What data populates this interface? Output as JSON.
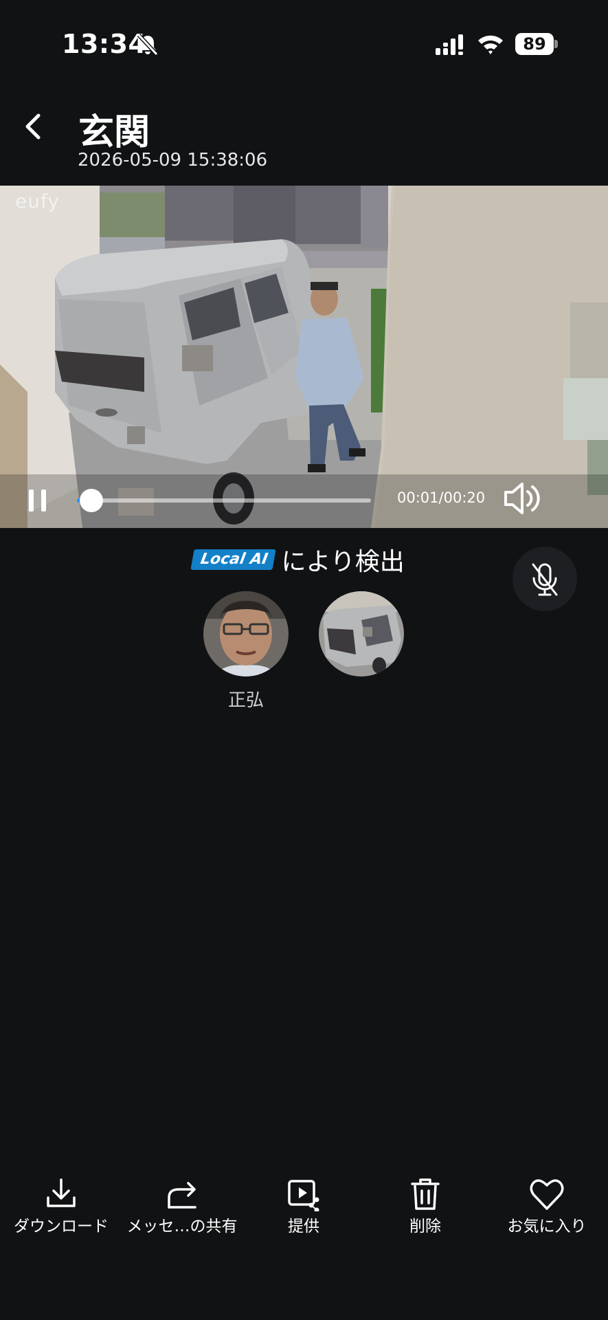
{
  "status_bar": {
    "time": "13:34",
    "battery": "89",
    "icons": [
      "bell-slash-icon",
      "cellular-signal-icon",
      "wifi-icon",
      "battery-icon"
    ]
  },
  "header": {
    "title": "玄関",
    "datetime": "2026-05-09 15:38:06"
  },
  "video": {
    "watermark": "eufy",
    "time_current": "00:01",
    "time_total": "00:20",
    "time_readout": "00:01/00:20",
    "progress": 0.05,
    "playing": true
  },
  "detection": {
    "badge": "Local AI",
    "label": "により検出",
    "badge_color": "#1380c8",
    "faces": [
      {
        "name": "正弘"
      }
    ]
  },
  "toolbar": {
    "items": [
      {
        "label": "ダウンロード",
        "icon": "download-icon"
      },
      {
        "label": "メッセ…の共有",
        "icon": "share-icon"
      },
      {
        "label": "提供",
        "icon": "video-share-icon"
      },
      {
        "label": "削除",
        "icon": "trash-icon"
      },
      {
        "label": "お気に入り",
        "icon": "heart-icon"
      }
    ]
  },
  "colors": {
    "background": "#111214",
    "accent": "#1f8fff"
  }
}
